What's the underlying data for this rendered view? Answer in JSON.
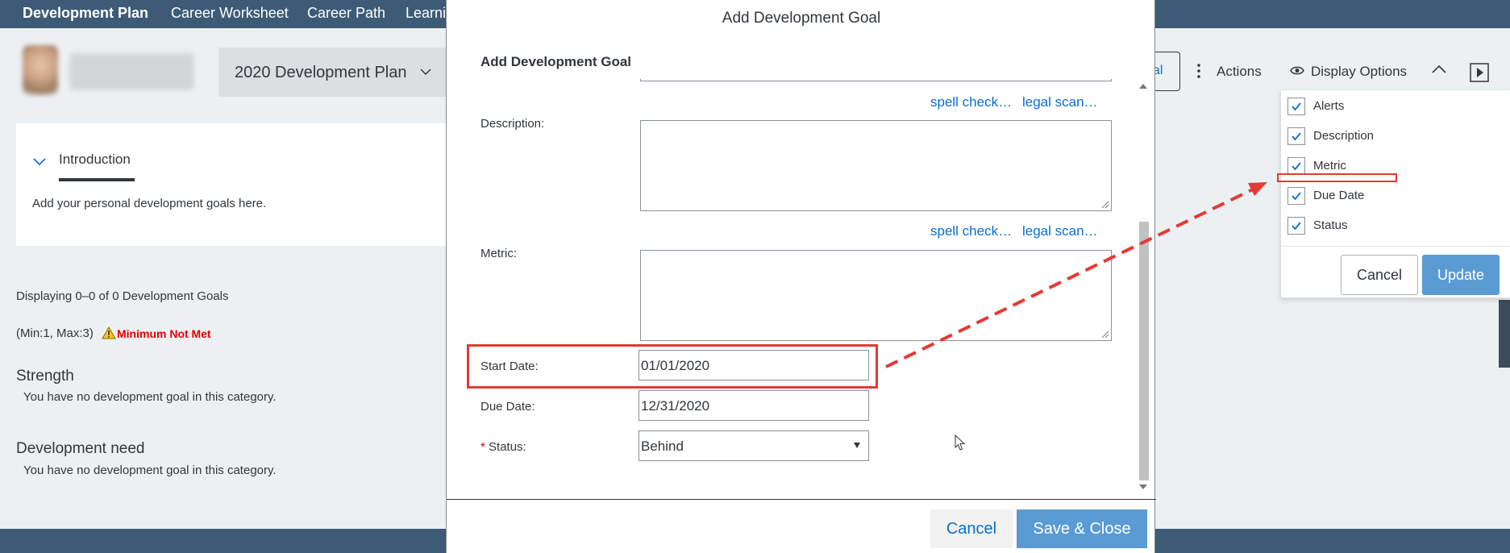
{
  "nav": {
    "items": [
      "Development Plan",
      "Career Worksheet",
      "Career Path",
      "Learni"
    ]
  },
  "header": {
    "plan_title": "2020 Development Plan",
    "edge_button_label": "al",
    "actions_label": "Actions",
    "display_options_label": "Display Options"
  },
  "intro": {
    "tab_label": "Introduction",
    "text": "Add your personal development goals here."
  },
  "goals": {
    "displaying": "Displaying 0–0 of 0 Development Goals",
    "min_max": "(Min:1, Max:3)",
    "warning": "Minimum Not Met",
    "sections": [
      {
        "title": "Strength",
        "empty": "You have no development goal in this category."
      },
      {
        "title": "Development need",
        "empty": "You have no development goal in this category."
      }
    ]
  },
  "dialog": {
    "title": "Add Development Goal",
    "subtitle": "Add Development Goal",
    "spell_check": "spell check…",
    "legal_scan": "legal scan…",
    "description_label": "Description:",
    "metric_label": "Metric:",
    "start_date_label": "Start Date:",
    "start_date_value": "01/01/2020",
    "due_date_label": "Due Date:",
    "due_date_value": "12/31/2020",
    "status_required": "*",
    "status_label": "Status:",
    "status_value": "Behind",
    "cancel_label": "Cancel",
    "save_label": "Save & Close"
  },
  "display_options": {
    "options": [
      {
        "label": "Alerts",
        "checked": true
      },
      {
        "label": "Description",
        "checked": true
      },
      {
        "label": "Metric",
        "checked": true
      },
      {
        "label": "Due Date",
        "checked": true
      },
      {
        "label": "Status",
        "checked": true
      }
    ],
    "cancel_label": "Cancel",
    "update_label": "Update"
  },
  "colors": {
    "nav_bg": "#3d5b76",
    "link": "#0a6ed1",
    "primary_button": "#5a9bd4",
    "annotation_red": "#e53935",
    "warning_red": "#e00000"
  }
}
